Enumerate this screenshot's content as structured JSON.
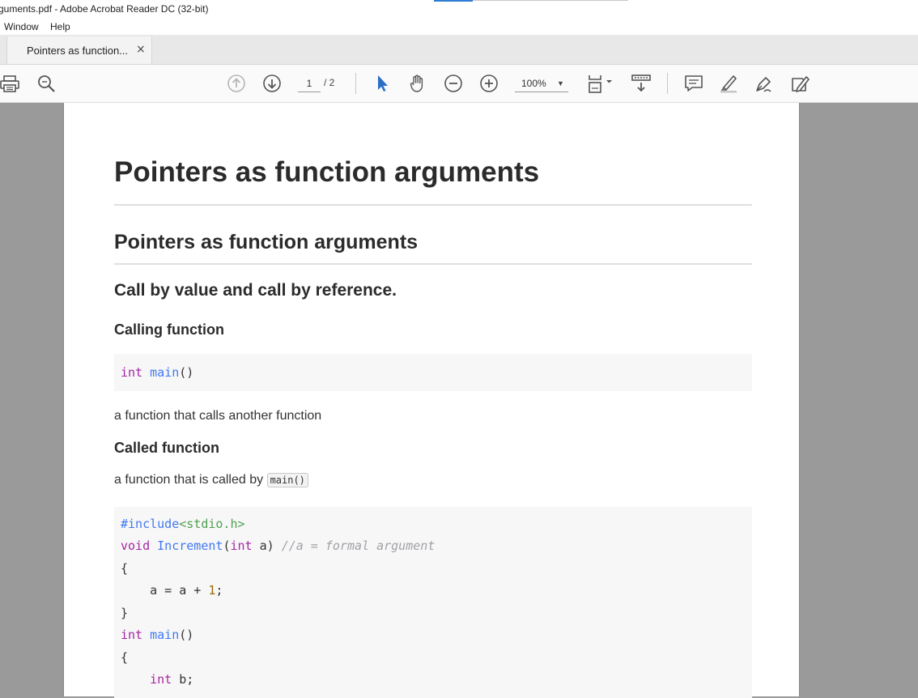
{
  "window": {
    "title": "guments.pdf - Adobe Acrobat Reader DC (32-bit)"
  },
  "menu": {
    "items": [
      "Window",
      "Help"
    ]
  },
  "tab": {
    "label": "Pointers as function...",
    "close": "×"
  },
  "toolbar": {
    "page_current": "1",
    "page_total": "/ 2",
    "zoom": "100%"
  },
  "document": {
    "h1": "Pointers as function arguments",
    "h2": "Pointers as function arguments",
    "h3": "Call by value and call by reference.",
    "calling_heading": "Calling function",
    "calling_code": {
      "kw": "int",
      "fn": "main",
      "rest": "()"
    },
    "calling_desc": "a function that calls another function",
    "called_heading": "Called function",
    "called_desc_prefix": "a function that is called by",
    "called_desc_code": "main()",
    "code_block": {
      "l1_pp": "#include",
      "l1_str": "<stdio.h>",
      "l2_kw": "void",
      "l2_fn": "Increment",
      "l2_open": "(",
      "l2_kw2": "int",
      "l2_rest": " a) ",
      "l2_cm": "//a = formal argument",
      "l3": "{",
      "l4_pre": "    a = a + ",
      "l4_num": "1",
      "l4_post": ";",
      "l5": "}",
      "l6_kw": "int",
      "l6_fn": "main",
      "l6_rest": "()",
      "l7": "{",
      "l8_pre": "    ",
      "l8_kw": "int",
      "l8_rest": " b;"
    }
  }
}
